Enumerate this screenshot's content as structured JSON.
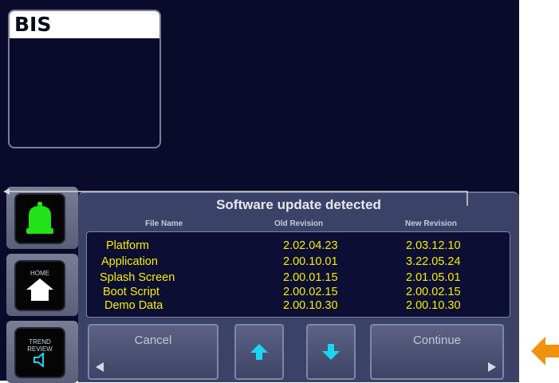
{
  "bis": {
    "title": "BIS"
  },
  "side_buttons": {
    "home_label": "HOME",
    "trend_line1": "TREND",
    "trend_line2": "REVIEW"
  },
  "dialog": {
    "title": "Software update detected",
    "columns": {
      "file": "File Name",
      "old": "Old Revision",
      "new": "New Revision"
    },
    "rows": [
      {
        "name": "Platform",
        "old": "2.02.04.23",
        "new": "2.03.12.10"
      },
      {
        "name": "Application",
        "old": "2.00.10.01",
        "new": "3.22.05.24"
      },
      {
        "name": "Splash Screen",
        "old": "2.00.01.15",
        "new": "2.01.05.01"
      },
      {
        "name": "Boot Script",
        "old": "2.00.02.15",
        "new": "2.00.02.15"
      },
      {
        "name": "Demo Data",
        "old": "2.00.10.30",
        "new": "2.00.10.30"
      }
    ],
    "cancel_label": "Cancel",
    "continue_label": "Continue"
  },
  "colors": {
    "screen_bg": "#0a0a2a",
    "dialog_bg": "#3b4268",
    "table_text": "#f6f000",
    "alarm_green": "#22e31a",
    "arrow_cyan": "#19d7f0",
    "callout_orange": "#f0920e"
  },
  "icons": {
    "alarm": "bell-icon",
    "home": "house-icon",
    "trend": "speaker-icon",
    "scroll_up": "arrow-up-icon",
    "scroll_down": "arrow-down-icon",
    "callout": "arrow-left-icon"
  }
}
